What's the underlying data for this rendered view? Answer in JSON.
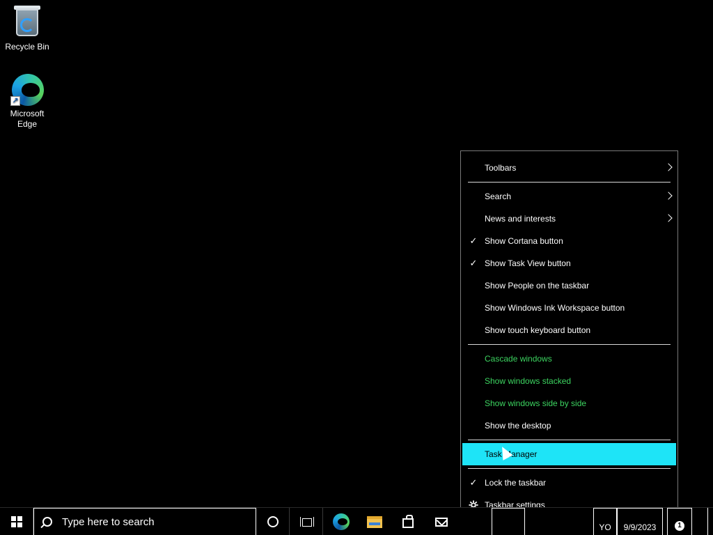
{
  "desktop": {
    "icons": [
      {
        "label": "Recycle Bin",
        "icon": "recycle-bin-icon"
      },
      {
        "label": "Microsoft Edge",
        "icon": "edge-icon"
      }
    ]
  },
  "context_menu": {
    "groups": [
      [
        {
          "label": "Toolbars",
          "submenu": true
        }
      ],
      [
        {
          "label": "Search",
          "submenu": true
        },
        {
          "label": "News and interests",
          "submenu": true
        },
        {
          "label": "Show Cortana button",
          "checked": true
        },
        {
          "label": "Show Task View button",
          "checked": true
        },
        {
          "label": "Show People on the taskbar"
        },
        {
          "label": "Show Windows Ink Workspace button"
        },
        {
          "label": "Show touch keyboard button"
        }
      ],
      [
        {
          "label": "Cascade windows",
          "disabled": true
        },
        {
          "label": "Show windows stacked",
          "disabled": true
        },
        {
          "label": "Show windows side by side",
          "disabled": true
        },
        {
          "label": "Show the desktop"
        }
      ],
      [
        {
          "label": "Task Manager",
          "highlighted": true
        }
      ],
      [
        {
          "label": "Lock the taskbar",
          "checked": true
        },
        {
          "label": "Taskbar settings",
          "icon": "gear-icon"
        }
      ]
    ],
    "check_glyph": "✓",
    "highlight_color": "#1ee4f7",
    "disabled_color": "#3cd460"
  },
  "taskbar": {
    "search_placeholder": "Type here to search",
    "language": "YO",
    "date": "9/9/2023",
    "notification_count": "1",
    "pinned": [
      "edge-icon",
      "file-explorer-icon",
      "store-icon",
      "mail-icon"
    ]
  }
}
